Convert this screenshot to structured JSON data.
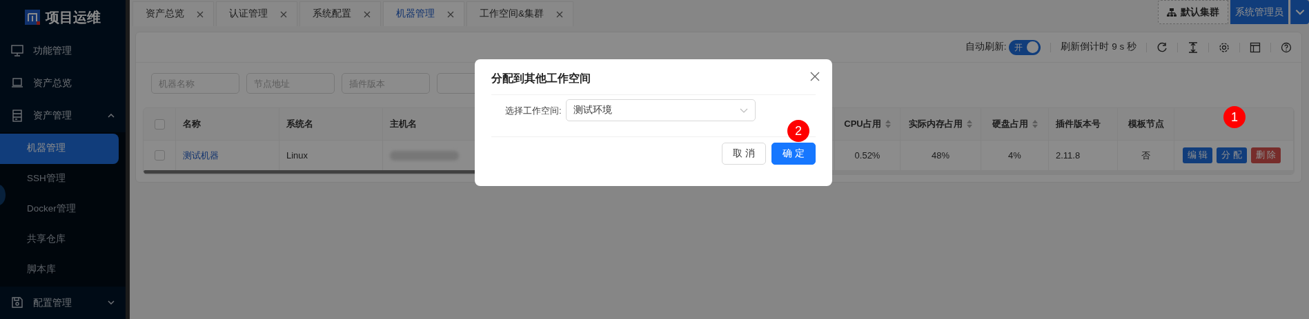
{
  "sidebar": {
    "logo": "项目运维",
    "items": [
      {
        "label": "功能管理",
        "selected": false
      },
      {
        "label": "资产总览",
        "selected": false
      },
      {
        "label": "资产管理",
        "selected": false,
        "expanded": true,
        "children": [
          {
            "label": "机器管理",
            "selected": true
          },
          {
            "label": "SSH管理",
            "selected": false
          },
          {
            "label": "Docker管理",
            "selected": false
          },
          {
            "label": "共享仓库",
            "selected": false
          },
          {
            "label": "脚本库",
            "selected": false
          }
        ]
      },
      {
        "label": "配置管理",
        "selected": false,
        "expanded": false
      }
    ]
  },
  "tabs": [
    {
      "label": "资产总览",
      "selected": false
    },
    {
      "label": "认证管理",
      "selected": false
    },
    {
      "label": "系统配置",
      "selected": false
    },
    {
      "label": "机器管理",
      "selected": true
    },
    {
      "label": "工作空间&集群",
      "selected": false
    }
  ],
  "header": {
    "cluster": "默认集群",
    "user": "系统管理员"
  },
  "toolbar": {
    "auto_refresh_label": "自动刷新:",
    "auto_refresh": {
      "on": true,
      "label": "开"
    },
    "countdown": "刷新倒计时 9 s 秒"
  },
  "filters": [
    {
      "kind": "input",
      "placeholder": "机器名称"
    },
    {
      "kind": "input",
      "placeholder": "节点地址"
    },
    {
      "kind": "input",
      "placeholder": "插件版本"
    },
    {
      "kind": "input"
    }
  ],
  "table": {
    "columns": [
      {
        "kind": "checkbox",
        "checked": false
      },
      {
        "label": "名称",
        "sortable": false
      },
      {
        "label": "系统名",
        "sortable": false
      },
      {
        "label": "主机名",
        "sortable": false
      },
      {
        "label": "CPU占用",
        "sortable": true
      },
      {
        "label": "实际内存占用",
        "sortable": true
      },
      {
        "label": "硬盘占用",
        "sortable": true
      },
      {
        "label": "插件版本号",
        "sortable": false
      },
      {
        "label": "模板节点",
        "sortable": false
      },
      {
        "kind": "actions"
      }
    ],
    "rows": [
      {
        "cells": [
          {
            "kind": "checkbox",
            "checked": false
          },
          {
            "kind": "link",
            "text": "测试机器"
          },
          {
            "kind": "text",
            "text": "Linux"
          },
          {
            "kind": "redacted"
          },
          {
            "kind": "number",
            "text": "0.52%"
          },
          {
            "kind": "number",
            "text": "48%"
          },
          {
            "kind": "number",
            "text": "4%"
          },
          {
            "kind": "text",
            "text": "2.11.8"
          },
          {
            "kind": "number",
            "text": "否"
          },
          {
            "kind": "actions",
            "buttons": [
              {
                "label": "编 辑",
                "kind": "primary"
              },
              {
                "label": "分 配",
                "kind": "primary"
              },
              {
                "label": "删 除",
                "kind": "danger"
              }
            ]
          }
        ]
      }
    ]
  },
  "modal": {
    "title": "分配到其他工作空间",
    "field_label": "选择工作空间:",
    "select_value": "测试环境",
    "buttons": [
      {
        "label": "取 消",
        "kind": "default"
      },
      {
        "label": "确 定",
        "kind": "primary"
      }
    ]
  },
  "markers": [
    {
      "label": "1"
    },
    {
      "label": "2"
    }
  ]
}
